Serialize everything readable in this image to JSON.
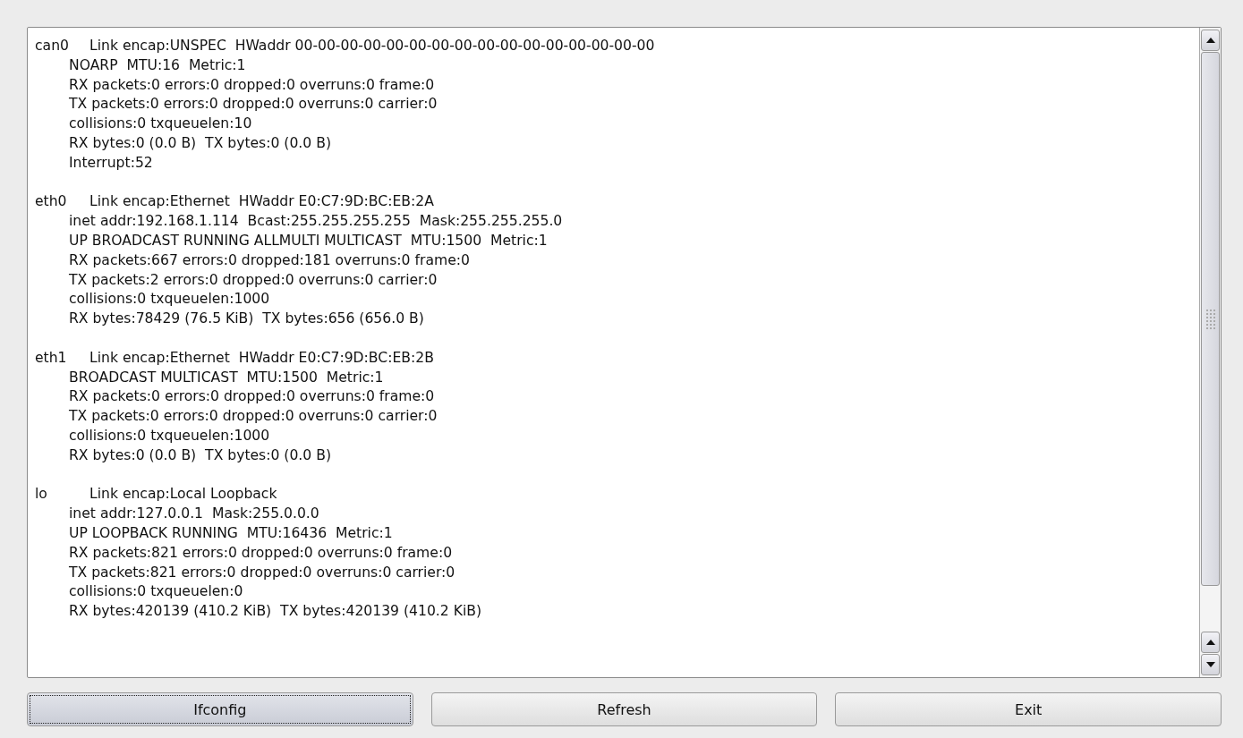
{
  "output": {
    "interfaces": [
      {
        "name": "can0",
        "lines": [
          "Link encap:UNSPEC  HWaddr 00-00-00-00-00-00-00-00-00-00-00-00-00-00-00-00",
          "NOARP  MTU:16  Metric:1",
          "RX packets:0 errors:0 dropped:0 overruns:0 frame:0",
          "TX packets:0 errors:0 dropped:0 overruns:0 carrier:0",
          "collisions:0 txqueuelen:10",
          "RX bytes:0 (0.0 B)  TX bytes:0 (0.0 B)",
          "Interrupt:52"
        ]
      },
      {
        "name": "eth0",
        "lines": [
          "Link encap:Ethernet  HWaddr E0:C7:9D:BC:EB:2A",
          "inet addr:192.168.1.114  Bcast:255.255.255.255  Mask:255.255.255.0",
          "UP BROADCAST RUNNING ALLMULTI MULTICAST  MTU:1500  Metric:1",
          "RX packets:667 errors:0 dropped:181 overruns:0 frame:0",
          "TX packets:2 errors:0 dropped:0 overruns:0 carrier:0",
          "collisions:0 txqueuelen:1000",
          "RX bytes:78429 (76.5 KiB)  TX bytes:656 (656.0 B)"
        ]
      },
      {
        "name": "eth1",
        "lines": [
          "Link encap:Ethernet  HWaddr E0:C7:9D:BC:EB:2B",
          "BROADCAST MULTICAST  MTU:1500  Metric:1",
          "RX packets:0 errors:0 dropped:0 overruns:0 frame:0",
          "TX packets:0 errors:0 dropped:0 overruns:0 carrier:0",
          "collisions:0 txqueuelen:1000",
          "RX bytes:0 (0.0 B)  TX bytes:0 (0.0 B)"
        ]
      },
      {
        "name": "lo",
        "lines": [
          "Link encap:Local Loopback",
          "inet addr:127.0.0.1  Mask:255.0.0.0",
          "UP LOOPBACK RUNNING  MTU:16436  Metric:1",
          "RX packets:821 errors:0 dropped:0 overruns:0 frame:0",
          "TX packets:821 errors:0 dropped:0 overruns:0 carrier:0",
          "collisions:0 txqueuelen:0",
          "RX bytes:420139 (410.2 KiB)  TX bytes:420139 (410.2 KiB)"
        ]
      }
    ]
  },
  "buttons": [
    {
      "label": "Ifconfig",
      "focused": true
    },
    {
      "label": "Refresh",
      "focused": false
    },
    {
      "label": "Exit",
      "focused": false
    }
  ]
}
